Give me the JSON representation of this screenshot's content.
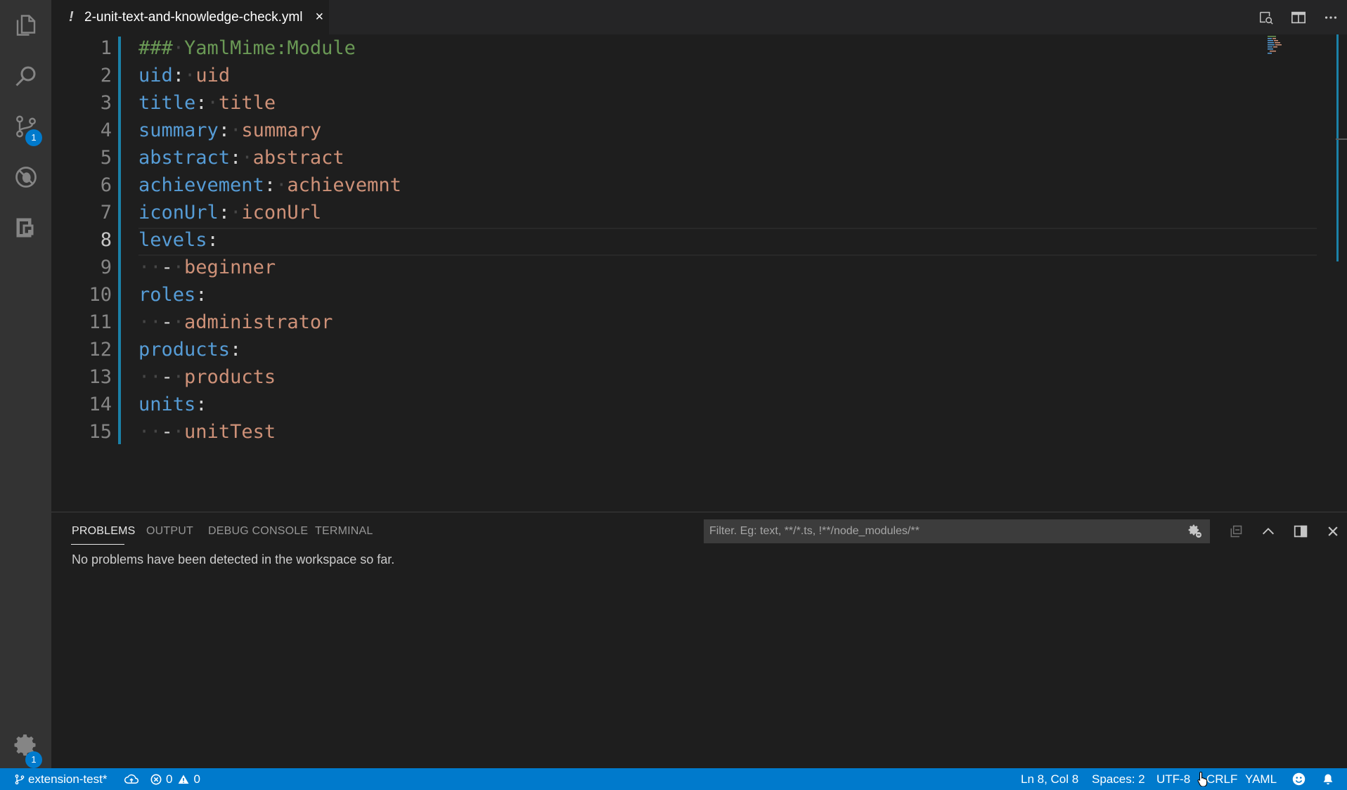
{
  "tab": {
    "modified_marker": "!",
    "title": "2-unit-text-and-knowledge-check.yml",
    "close": "×"
  },
  "activity_bar": {
    "items": [
      {
        "icon": "files-icon"
      },
      {
        "icon": "search-icon"
      },
      {
        "icon": "source-control-icon",
        "badge": "1"
      },
      {
        "icon": "debug-icon"
      },
      {
        "icon": "extensions-icon"
      }
    ],
    "settings_badge": "1"
  },
  "editor": {
    "active_line": 8,
    "lines": [
      {
        "n": "1",
        "parts": [
          [
            "cm",
            "###"
          ],
          [
            "ws",
            "·"
          ],
          [
            "cm",
            "YamlMime:Module"
          ]
        ]
      },
      {
        "n": "2",
        "parts": [
          [
            "k",
            "uid"
          ],
          [
            "p",
            ":"
          ],
          [
            "ws",
            "·"
          ],
          [
            "v",
            "uid"
          ]
        ]
      },
      {
        "n": "3",
        "parts": [
          [
            "k",
            "title"
          ],
          [
            "p",
            ":"
          ],
          [
            "ws",
            "·"
          ],
          [
            "v",
            "title"
          ]
        ]
      },
      {
        "n": "4",
        "parts": [
          [
            "k",
            "summary"
          ],
          [
            "p",
            ":"
          ],
          [
            "ws",
            "·"
          ],
          [
            "v",
            "summary"
          ]
        ]
      },
      {
        "n": "5",
        "parts": [
          [
            "k",
            "abstract"
          ],
          [
            "p",
            ":"
          ],
          [
            "ws",
            "·"
          ],
          [
            "v",
            "abstract"
          ]
        ]
      },
      {
        "n": "6",
        "parts": [
          [
            "k",
            "achievement"
          ],
          [
            "p",
            ":"
          ],
          [
            "ws",
            "·"
          ],
          [
            "v",
            "achievemnt"
          ]
        ]
      },
      {
        "n": "7",
        "parts": [
          [
            "k",
            "iconUrl"
          ],
          [
            "p",
            ":"
          ],
          [
            "ws",
            "·"
          ],
          [
            "v",
            "iconUrl"
          ]
        ]
      },
      {
        "n": "8",
        "parts": [
          [
            "k",
            "levels"
          ],
          [
            "p",
            ":"
          ]
        ]
      },
      {
        "n": "9",
        "parts": [
          [
            "ws",
            "··"
          ],
          [
            "p",
            "-"
          ],
          [
            "ws",
            "·"
          ],
          [
            "v",
            "beginner"
          ]
        ]
      },
      {
        "n": "10",
        "parts": [
          [
            "k",
            "roles"
          ],
          [
            "p",
            ":"
          ]
        ]
      },
      {
        "n": "11",
        "parts": [
          [
            "ws",
            "··"
          ],
          [
            "p",
            "-"
          ],
          [
            "ws",
            "·"
          ],
          [
            "v",
            "administrator"
          ]
        ]
      },
      {
        "n": "12",
        "parts": [
          [
            "k",
            "products"
          ],
          [
            "p",
            ":"
          ]
        ]
      },
      {
        "n": "13",
        "parts": [
          [
            "ws",
            "··"
          ],
          [
            "p",
            "-"
          ],
          [
            "ws",
            "·"
          ],
          [
            "v",
            "products"
          ]
        ]
      },
      {
        "n": "14",
        "parts": [
          [
            "k",
            "units"
          ],
          [
            "p",
            ":"
          ]
        ]
      },
      {
        "n": "15",
        "parts": [
          [
            "ws",
            "··"
          ],
          [
            "p",
            "-"
          ],
          [
            "ws",
            "·"
          ],
          [
            "v",
            "unitTest"
          ]
        ]
      }
    ]
  },
  "panel": {
    "tabs": [
      "PROBLEMS",
      "OUTPUT",
      "DEBUG CONSOLE",
      "TERMINAL"
    ],
    "filter_placeholder": "Filter. Eg: text, **/*.ts, !**/node_modules/**",
    "message": "No problems have been detected in the workspace so far."
  },
  "status_bar": {
    "branch": "extension-test*",
    "errors": "0",
    "warnings": "0",
    "position": "Ln 8, Col 8",
    "spaces": "Spaces: 2",
    "encoding": "UTF-8",
    "eol": "CRLF",
    "language": "YAML"
  },
  "colors": {
    "accent": "#007acc",
    "key": "#569cd6",
    "value": "#ce9178",
    "comment": "#6a9955"
  }
}
